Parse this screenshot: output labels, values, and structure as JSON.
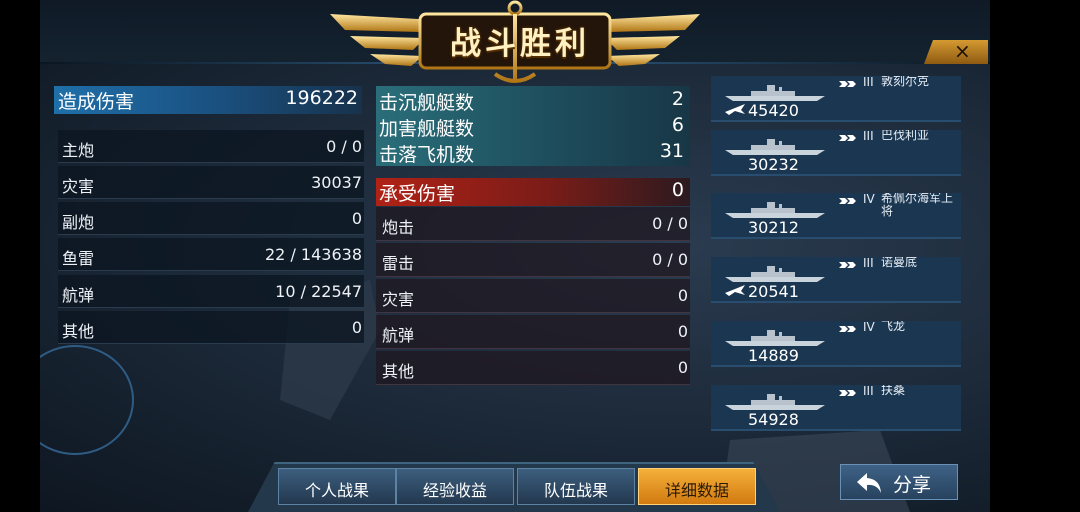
{
  "title": "战斗胜利",
  "close_label": "×",
  "damage": {
    "header_label": "造成伤害",
    "header_value": "196222",
    "rows": [
      {
        "label": "主炮",
        "value": "0 / 0"
      },
      {
        "label": "灾害",
        "value": "30037"
      },
      {
        "label": "副炮",
        "value": "0"
      },
      {
        "label": "鱼雷",
        "value": "22 / 143638"
      },
      {
        "label": "航弹",
        "value": "10 / 22547"
      },
      {
        "label": "其他",
        "value": "0"
      }
    ]
  },
  "kills": [
    {
      "label": "击沉舰艇数",
      "value": "2"
    },
    {
      "label": "加害舰艇数",
      "value": "6"
    },
    {
      "label": "击落飞机数",
      "value": "31"
    }
  ],
  "received": {
    "header_label": "承受伤害",
    "header_value": "0",
    "rows": [
      {
        "label": "炮击",
        "value": "0 / 0"
      },
      {
        "label": "雷击",
        "value": "0 / 0"
      },
      {
        "label": "灾害",
        "value": "0"
      },
      {
        "label": "航弹",
        "value": "0"
      },
      {
        "label": "其他",
        "value": "0"
      }
    ]
  },
  "ships": [
    {
      "tier": "III",
      "name": "敦刻尔克",
      "score": "45420",
      "plane": true
    },
    {
      "tier": "III",
      "name": "巴伐利亚",
      "score": "30232",
      "plane": false
    },
    {
      "tier": "IV",
      "name": "希佩尔海军上将",
      "score": "30212",
      "plane": false
    },
    {
      "tier": "III",
      "name": "诺曼底",
      "score": "20541",
      "plane": true
    },
    {
      "tier": "IV",
      "name": "飞龙",
      "score": "14889",
      "plane": false
    },
    {
      "tier": "III",
      "name": "扶桑",
      "score": "54928",
      "plane": false
    }
  ],
  "tabs": [
    {
      "label": "个人战果",
      "active": false
    },
    {
      "label": "经验收益",
      "active": false
    },
    {
      "label": "队伍战果",
      "active": false
    },
    {
      "label": "详细数据",
      "active": true
    }
  ],
  "share_label": "分享",
  "colors": {
    "gold": "#d59a32",
    "damage_blue": "#1f6fa9",
    "received_red": "#b02216",
    "kill_teal": "#2a6e7a",
    "active_tab": "#f5b03a"
  },
  "icons": [
    "anchor-emblem-icon",
    "close-icon",
    "plane-icon",
    "rank-chevron-icon",
    "share-arrow-icon"
  ]
}
